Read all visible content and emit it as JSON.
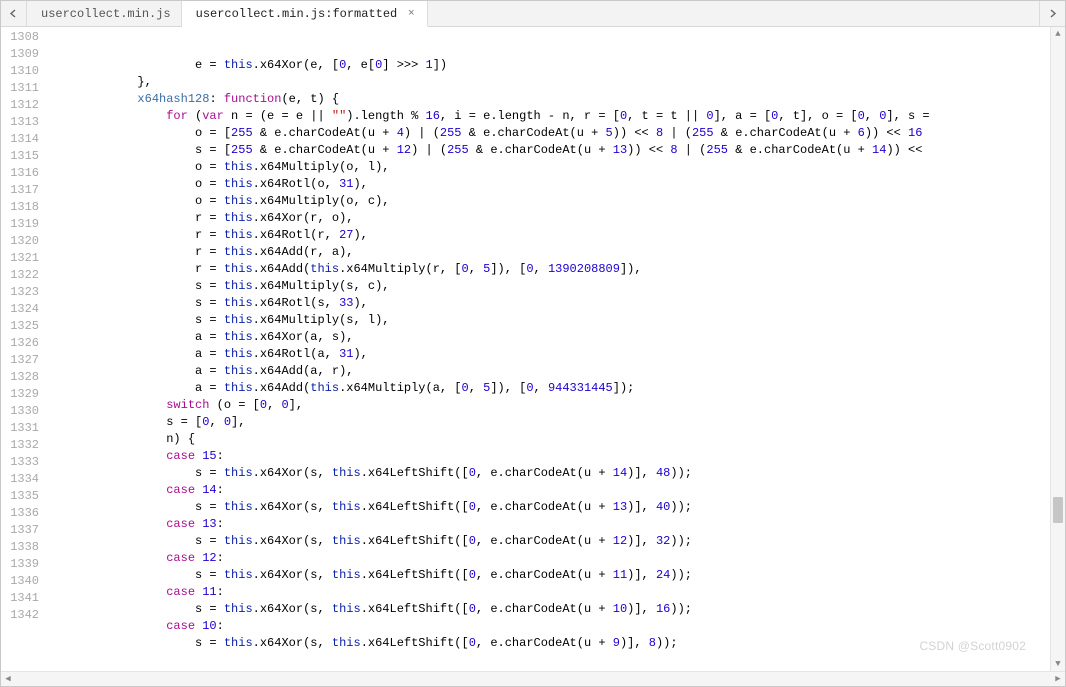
{
  "tabs": [
    {
      "label": "usercollect.min.js",
      "active": false,
      "closable": false
    },
    {
      "label": "usercollect.min.js:formatted",
      "active": true,
      "closable": true
    }
  ],
  "watermark": "CSDN @Scott0902",
  "gutter_start": 1308,
  "gutter_end": 1342,
  "code_lines": [
    {
      "indent": 20,
      "tokens": [
        "id:e = ",
        "thisk:this",
        "p:.x64Xor(e, [",
        "n:0",
        "p:, e[",
        "n:0",
        "p:] >>> ",
        "n:1",
        "p:])"
      ]
    },
    {
      "indent": 12,
      "tokens": [
        "p:},"
      ]
    },
    {
      "indent": 12,
      "tokens": [
        "def:x64hash128",
        "p:: ",
        "kw:function",
        "p:(e, t) {"
      ]
    },
    {
      "indent": 16,
      "tokens": [
        "kw:for",
        "p: (",
        "kw:var",
        "p: n = (e = e || ",
        "s:\"\"",
        "p:).length % ",
        "n:16",
        "p:, i = e.length - n, r = [",
        "n:0",
        "p:, t = t || ",
        "n:0",
        "p:], a = [",
        "n:0",
        "p:, t], o = [",
        "n:0",
        "p:, ",
        "n:0",
        "p:], s ="
      ]
    },
    {
      "indent": 20,
      "tokens": [
        "id:o = [",
        "n:255",
        "p: & e.charCodeAt(u + ",
        "n:4",
        "p:) | (",
        "n:255",
        "p: & e.charCodeAt(u + ",
        "n:5",
        "p:)) << ",
        "n:8",
        "p: | (",
        "n:255",
        "p: & e.charCodeAt(u + ",
        "n:6",
        "p:)) << ",
        "n:16"
      ]
    },
    {
      "indent": 20,
      "tokens": [
        "id:s = [",
        "n:255",
        "p: & e.charCodeAt(u + ",
        "n:12",
        "p:) | (",
        "n:255",
        "p: & e.charCodeAt(u + ",
        "n:13",
        "p:)) << ",
        "n:8",
        "p: | (",
        "n:255",
        "p: & e.charCodeAt(u + ",
        "n:14",
        "p:)) <<"
      ]
    },
    {
      "indent": 20,
      "tokens": [
        "id:o = ",
        "thisk:this",
        "p:.x64Multiply(o, l),"
      ]
    },
    {
      "indent": 20,
      "tokens": [
        "id:o = ",
        "thisk:this",
        "p:.x64Rotl(o, ",
        "n:31",
        "p:),"
      ]
    },
    {
      "indent": 20,
      "tokens": [
        "id:o = ",
        "thisk:this",
        "p:.x64Multiply(o, c),"
      ]
    },
    {
      "indent": 20,
      "tokens": [
        "id:r = ",
        "thisk:this",
        "p:.x64Xor(r, o),"
      ]
    },
    {
      "indent": 20,
      "tokens": [
        "id:r = ",
        "thisk:this",
        "p:.x64Rotl(r, ",
        "n:27",
        "p:),"
      ]
    },
    {
      "indent": 20,
      "tokens": [
        "id:r = ",
        "thisk:this",
        "p:.x64Add(r, a),"
      ]
    },
    {
      "indent": 20,
      "tokens": [
        "id:r = ",
        "thisk:this",
        "p:.x64Add(",
        "thisk:this",
        "p:.x64Multiply(r, [",
        "n:0",
        "p:, ",
        "n:5",
        "p:]), [",
        "n:0",
        "p:, ",
        "n:1390208809",
        "p:]),"
      ]
    },
    {
      "indent": 20,
      "tokens": [
        "id:s = ",
        "thisk:this",
        "p:.x64Multiply(s, c),"
      ]
    },
    {
      "indent": 20,
      "tokens": [
        "id:s = ",
        "thisk:this",
        "p:.x64Rotl(s, ",
        "n:33",
        "p:),"
      ]
    },
    {
      "indent": 20,
      "tokens": [
        "id:s = ",
        "thisk:this",
        "p:.x64Multiply(s, l),"
      ]
    },
    {
      "indent": 20,
      "tokens": [
        "id:a = ",
        "thisk:this",
        "p:.x64Xor(a, s),"
      ]
    },
    {
      "indent": 20,
      "tokens": [
        "id:a = ",
        "thisk:this",
        "p:.x64Rotl(a, ",
        "n:31",
        "p:),"
      ]
    },
    {
      "indent": 20,
      "tokens": [
        "id:a = ",
        "thisk:this",
        "p:.x64Add(a, r),"
      ]
    },
    {
      "indent": 20,
      "tokens": [
        "id:a = ",
        "thisk:this",
        "p:.x64Add(",
        "thisk:this",
        "p:.x64Multiply(a, [",
        "n:0",
        "p:, ",
        "n:5",
        "p:]), [",
        "n:0",
        "p:, ",
        "n:944331445",
        "p:]);"
      ]
    },
    {
      "indent": 16,
      "tokens": [
        "kw:switch",
        "p: (o = [",
        "n:0",
        "p:, ",
        "n:0",
        "p:],"
      ]
    },
    {
      "indent": 16,
      "tokens": [
        "id:s = [",
        "n:0",
        "p:, ",
        "n:0",
        "p:],"
      ]
    },
    {
      "indent": 16,
      "tokens": [
        "id:n) {"
      ]
    },
    {
      "indent": 16,
      "tokens": [
        "kw:case",
        "p: ",
        "n:15",
        "p::"
      ]
    },
    {
      "indent": 20,
      "tokens": [
        "id:s = ",
        "thisk:this",
        "p:.x64Xor(s, ",
        "thisk:this",
        "p:.x64LeftShift([",
        "n:0",
        "p:, e.charCodeAt(u + ",
        "n:14",
        "p:)], ",
        "n:48",
        "p:));"
      ]
    },
    {
      "indent": 16,
      "tokens": [
        "kw:case",
        "p: ",
        "n:14",
        "p::"
      ]
    },
    {
      "indent": 20,
      "tokens": [
        "id:s = ",
        "thisk:this",
        "p:.x64Xor(s, ",
        "thisk:this",
        "p:.x64LeftShift([",
        "n:0",
        "p:, e.charCodeAt(u + ",
        "n:13",
        "p:)], ",
        "n:40",
        "p:));"
      ]
    },
    {
      "indent": 16,
      "tokens": [
        "kw:case",
        "p: ",
        "n:13",
        "p::"
      ]
    },
    {
      "indent": 20,
      "tokens": [
        "id:s = ",
        "thisk:this",
        "p:.x64Xor(s, ",
        "thisk:this",
        "p:.x64LeftShift([",
        "n:0",
        "p:, e.charCodeAt(u + ",
        "n:12",
        "p:)], ",
        "n:32",
        "p:));"
      ]
    },
    {
      "indent": 16,
      "tokens": [
        "kw:case",
        "p: ",
        "n:12",
        "p::"
      ]
    },
    {
      "indent": 20,
      "tokens": [
        "id:s = ",
        "thisk:this",
        "p:.x64Xor(s, ",
        "thisk:this",
        "p:.x64LeftShift([",
        "n:0",
        "p:, e.charCodeAt(u + ",
        "n:11",
        "p:)], ",
        "n:24",
        "p:));"
      ]
    },
    {
      "indent": 16,
      "tokens": [
        "kw:case",
        "p: ",
        "n:11",
        "p::"
      ]
    },
    {
      "indent": 20,
      "tokens": [
        "id:s = ",
        "thisk:this",
        "p:.x64Xor(s, ",
        "thisk:this",
        "p:.x64LeftShift([",
        "n:0",
        "p:, e.charCodeAt(u + ",
        "n:10",
        "p:)], ",
        "n:16",
        "p:));"
      ]
    },
    {
      "indent": 16,
      "tokens": [
        "kw:case",
        "p: ",
        "n:10",
        "p::"
      ]
    },
    {
      "indent": 20,
      "tokens": [
        "id:s = ",
        "thisk:this",
        "p:.x64Xor(s, ",
        "thisk:this",
        "p:.x64LeftShift([",
        "n:0",
        "p:, e.charCodeAt(u + ",
        "n:9",
        "p:)], ",
        "n:8",
        "p:));"
      ]
    }
  ]
}
